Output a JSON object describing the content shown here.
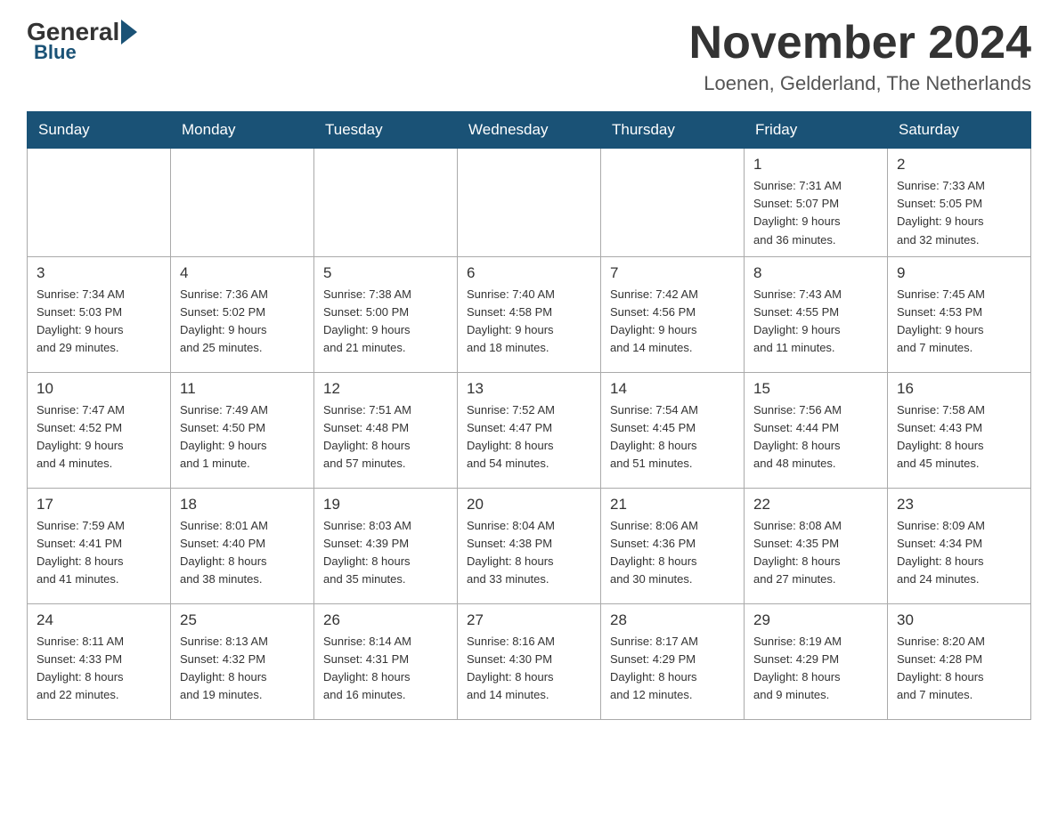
{
  "header": {
    "logo": {
      "general": "General",
      "blue": "Blue"
    },
    "month_title": "November 2024",
    "location": "Loenen, Gelderland, The Netherlands"
  },
  "weekdays": [
    "Sunday",
    "Monday",
    "Tuesday",
    "Wednesday",
    "Thursday",
    "Friday",
    "Saturday"
  ],
  "weeks": [
    [
      {
        "day": "",
        "info": ""
      },
      {
        "day": "",
        "info": ""
      },
      {
        "day": "",
        "info": ""
      },
      {
        "day": "",
        "info": ""
      },
      {
        "day": "",
        "info": ""
      },
      {
        "day": "1",
        "info": "Sunrise: 7:31 AM\nSunset: 5:07 PM\nDaylight: 9 hours\nand 36 minutes."
      },
      {
        "day": "2",
        "info": "Sunrise: 7:33 AM\nSunset: 5:05 PM\nDaylight: 9 hours\nand 32 minutes."
      }
    ],
    [
      {
        "day": "3",
        "info": "Sunrise: 7:34 AM\nSunset: 5:03 PM\nDaylight: 9 hours\nand 29 minutes."
      },
      {
        "day": "4",
        "info": "Sunrise: 7:36 AM\nSunset: 5:02 PM\nDaylight: 9 hours\nand 25 minutes."
      },
      {
        "day": "5",
        "info": "Sunrise: 7:38 AM\nSunset: 5:00 PM\nDaylight: 9 hours\nand 21 minutes."
      },
      {
        "day": "6",
        "info": "Sunrise: 7:40 AM\nSunset: 4:58 PM\nDaylight: 9 hours\nand 18 minutes."
      },
      {
        "day": "7",
        "info": "Sunrise: 7:42 AM\nSunset: 4:56 PM\nDaylight: 9 hours\nand 14 minutes."
      },
      {
        "day": "8",
        "info": "Sunrise: 7:43 AM\nSunset: 4:55 PM\nDaylight: 9 hours\nand 11 minutes."
      },
      {
        "day": "9",
        "info": "Sunrise: 7:45 AM\nSunset: 4:53 PM\nDaylight: 9 hours\nand 7 minutes."
      }
    ],
    [
      {
        "day": "10",
        "info": "Sunrise: 7:47 AM\nSunset: 4:52 PM\nDaylight: 9 hours\nand 4 minutes."
      },
      {
        "day": "11",
        "info": "Sunrise: 7:49 AM\nSunset: 4:50 PM\nDaylight: 9 hours\nand 1 minute."
      },
      {
        "day": "12",
        "info": "Sunrise: 7:51 AM\nSunset: 4:48 PM\nDaylight: 8 hours\nand 57 minutes."
      },
      {
        "day": "13",
        "info": "Sunrise: 7:52 AM\nSunset: 4:47 PM\nDaylight: 8 hours\nand 54 minutes."
      },
      {
        "day": "14",
        "info": "Sunrise: 7:54 AM\nSunset: 4:45 PM\nDaylight: 8 hours\nand 51 minutes."
      },
      {
        "day": "15",
        "info": "Sunrise: 7:56 AM\nSunset: 4:44 PM\nDaylight: 8 hours\nand 48 minutes."
      },
      {
        "day": "16",
        "info": "Sunrise: 7:58 AM\nSunset: 4:43 PM\nDaylight: 8 hours\nand 45 minutes."
      }
    ],
    [
      {
        "day": "17",
        "info": "Sunrise: 7:59 AM\nSunset: 4:41 PM\nDaylight: 8 hours\nand 41 minutes."
      },
      {
        "day": "18",
        "info": "Sunrise: 8:01 AM\nSunset: 4:40 PM\nDaylight: 8 hours\nand 38 minutes."
      },
      {
        "day": "19",
        "info": "Sunrise: 8:03 AM\nSunset: 4:39 PM\nDaylight: 8 hours\nand 35 minutes."
      },
      {
        "day": "20",
        "info": "Sunrise: 8:04 AM\nSunset: 4:38 PM\nDaylight: 8 hours\nand 33 minutes."
      },
      {
        "day": "21",
        "info": "Sunrise: 8:06 AM\nSunset: 4:36 PM\nDaylight: 8 hours\nand 30 minutes."
      },
      {
        "day": "22",
        "info": "Sunrise: 8:08 AM\nSunset: 4:35 PM\nDaylight: 8 hours\nand 27 minutes."
      },
      {
        "day": "23",
        "info": "Sunrise: 8:09 AM\nSunset: 4:34 PM\nDaylight: 8 hours\nand 24 minutes."
      }
    ],
    [
      {
        "day": "24",
        "info": "Sunrise: 8:11 AM\nSunset: 4:33 PM\nDaylight: 8 hours\nand 22 minutes."
      },
      {
        "day": "25",
        "info": "Sunrise: 8:13 AM\nSunset: 4:32 PM\nDaylight: 8 hours\nand 19 minutes."
      },
      {
        "day": "26",
        "info": "Sunrise: 8:14 AM\nSunset: 4:31 PM\nDaylight: 8 hours\nand 16 minutes."
      },
      {
        "day": "27",
        "info": "Sunrise: 8:16 AM\nSunset: 4:30 PM\nDaylight: 8 hours\nand 14 minutes."
      },
      {
        "day": "28",
        "info": "Sunrise: 8:17 AM\nSunset: 4:29 PM\nDaylight: 8 hours\nand 12 minutes."
      },
      {
        "day": "29",
        "info": "Sunrise: 8:19 AM\nSunset: 4:29 PM\nDaylight: 8 hours\nand 9 minutes."
      },
      {
        "day": "30",
        "info": "Sunrise: 8:20 AM\nSunset: 4:28 PM\nDaylight: 8 hours\nand 7 minutes."
      }
    ]
  ]
}
